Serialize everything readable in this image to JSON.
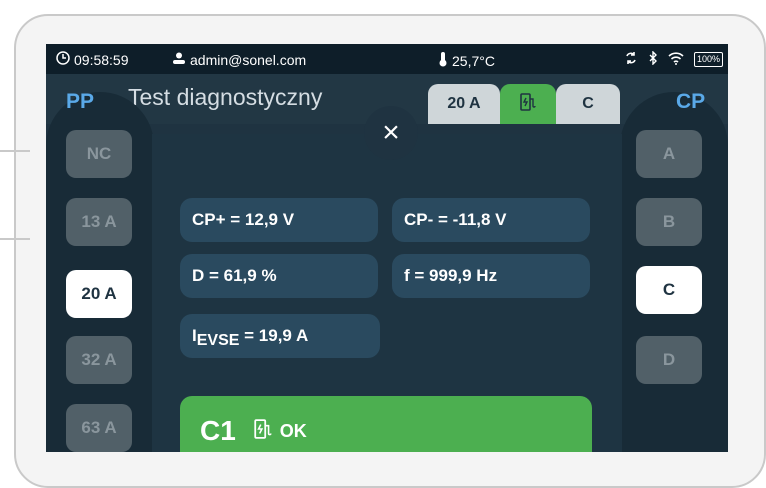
{
  "status_bar": {
    "time": "09:58:59",
    "user": "admin@sonel.com",
    "temperature": "25,7°C",
    "battery": "100%"
  },
  "header": {
    "pp_label": "PP",
    "title": "Test diagnostyczny",
    "cp_label": "CP",
    "chip_current": "20 A",
    "chip_cp": "C"
  },
  "pp_buttons": [
    "NC",
    "13 A",
    "20 A",
    "32 A",
    "63 A"
  ],
  "pp_selected": "20 A",
  "cp_buttons": [
    "A",
    "B",
    "C",
    "D"
  ],
  "cp_selected": "C",
  "modal": {
    "close": "×",
    "cp_plus": "CP+ = 12,9 V",
    "cp_minus": "CP- = -11,8 V",
    "duty": "D = 61,9 %",
    "freq": "f = 999,9 Hz",
    "ievse_prefix": "I",
    "ievse_sub": "EVSE",
    "ievse_value": " = 19,9 A",
    "result_code": "C1",
    "result_text": "OK"
  }
}
